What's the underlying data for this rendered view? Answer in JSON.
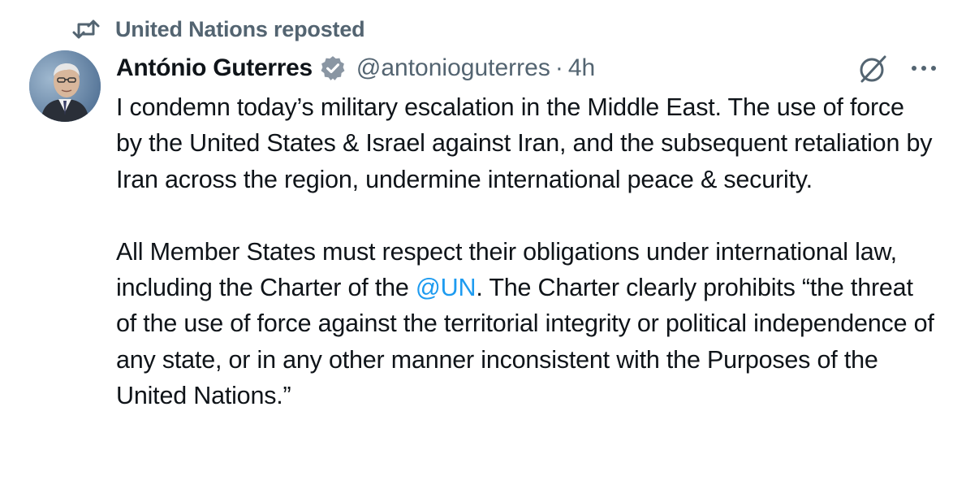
{
  "repost": {
    "label": "United Nations reposted",
    "icon": "repost-icon"
  },
  "author": {
    "name": "António Guterres",
    "handle": "@antonioguterres",
    "separator": "·",
    "time": "4h",
    "verified": true,
    "avatar_icon": "avatar"
  },
  "actions": {
    "grok_icon": "grok-icon",
    "more_icon": "more-icon"
  },
  "tweet": {
    "para1": "I condemn today’s military escalation in the Middle East. The use of force by the United States & Israel against Iran, and the subsequent retaliation by Iran across the region, undermine international peace & security.",
    "para2_before": "All Member States must respect their obligations under international law, including the Charter of the ",
    "mention": "@UN",
    "para2_after": ". The Charter clearly prohibits “the threat of the use of force against the territorial integrity or political independence of any state, or in any other manner inconsistent with the Purposes of the United Nations.”"
  },
  "colors": {
    "text": "#0f1419",
    "secondary": "#536471",
    "link": "#1d9bf0",
    "badge": "#8a96a3"
  }
}
